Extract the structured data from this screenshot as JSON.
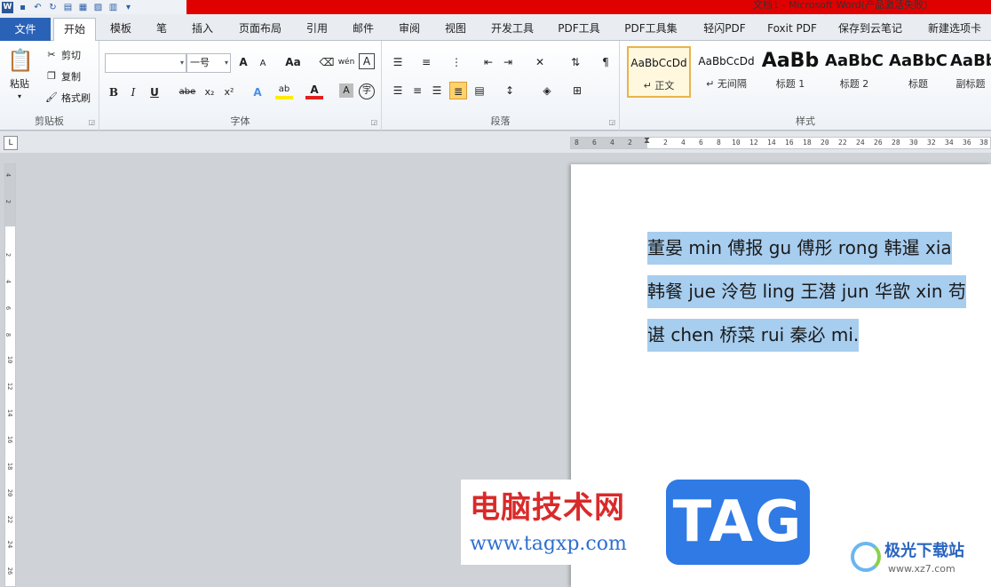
{
  "window": {
    "title": "文档1 - Microsoft Word(产品激活失败)",
    "qat_icons": [
      "word-logo",
      "save-icon",
      "undo-icon",
      "redo-icon",
      "new-doc-icon",
      "preview-icon",
      "print-icon",
      "layout-icon",
      "more-icon"
    ]
  },
  "tabs": {
    "file": "文件",
    "items": [
      "开始",
      "模板",
      "笔",
      "插入",
      "页面布局",
      "引用",
      "邮件",
      "审阅",
      "视图",
      "开发工具",
      "PDF工具",
      "PDF工具集",
      "轻闪PDF",
      "Foxit PDF",
      "保存到云笔记",
      "新建选项卡"
    ],
    "active_index": 0
  },
  "clipboard": {
    "label": "剪贴板",
    "paste": "粘贴",
    "cut": "剪切",
    "copy": "复制",
    "format_painter": "格式刷"
  },
  "font": {
    "label": "字体",
    "font_name": "",
    "font_size": "一号",
    "grow": "A",
    "shrink": "A",
    "change_case": "Aa",
    "bold": "B",
    "italic": "I",
    "underline": "U",
    "strike": "abe",
    "subscript": "x₂",
    "superscript": "x²",
    "pinyin": "wén"
  },
  "paragraph": {
    "label": "段落"
  },
  "styles": {
    "label": "样式",
    "items": [
      {
        "sample": "AaBbCcDd",
        "name": "↵ 正文",
        "selected": true
      },
      {
        "sample": "AaBbCcDd",
        "name": "↵ 无间隔",
        "selected": false
      },
      {
        "sample": "AaBb",
        "name": "标题 1",
        "selected": false
      },
      {
        "sample": "AaBbC",
        "name": "标题 2",
        "selected": false
      },
      {
        "sample": "AaBbC",
        "name": "标题",
        "selected": false
      },
      {
        "sample": "AaBb",
        "name": "副标题",
        "selected": false
      }
    ]
  },
  "ruler": {
    "corner": "L",
    "h_ticks": [
      "8",
      "6",
      "4",
      "2",
      "",
      "2",
      "4",
      "6",
      "8",
      "10",
      "12",
      "14",
      "16",
      "18",
      "20",
      "22",
      "24",
      "26",
      "28",
      "30",
      "32",
      "34",
      "36",
      "38"
    ],
    "v_ticks": [
      "4",
      "2",
      "",
      "2",
      "4",
      "6",
      "8",
      "10",
      "12",
      "14",
      "16",
      "18",
      "20",
      "22",
      "24",
      "26"
    ]
  },
  "document": {
    "lines": [
      "董晏 min 傅报 gu 傅彤 rong 韩暹 xia",
      "韩餐 jue 泠苞 ling 王潜 jun 华歆 xin 苟",
      "谌 chen 桥菜 rui 秦必 mi."
    ]
  },
  "watermark": {
    "site_cn": "电脑技术网",
    "site_url": "www.tagxp.com",
    "tag": "TAG",
    "right_cn": "极光下载站",
    "right_url": "www.xz7.com"
  }
}
